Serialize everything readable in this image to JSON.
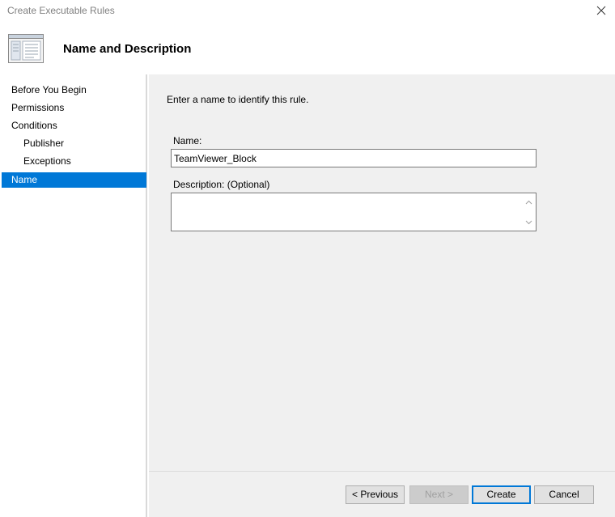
{
  "window": {
    "title": "Create Executable Rules"
  },
  "header": {
    "title": "Name and Description",
    "icon": "wizard-page-icon"
  },
  "nav": {
    "items": [
      {
        "label": "Before You Begin",
        "level": 0,
        "selected": false
      },
      {
        "label": "Permissions",
        "level": 0,
        "selected": false
      },
      {
        "label": "Conditions",
        "level": 0,
        "selected": false
      },
      {
        "label": "Publisher",
        "level": 1,
        "selected": false
      },
      {
        "label": "Exceptions",
        "level": 1,
        "selected": false
      },
      {
        "label": "Name",
        "level": 0,
        "selected": true
      }
    ]
  },
  "main": {
    "instruction": "Enter a name to identify this rule.",
    "name_label": "Name:",
    "name_value": "TeamViewer_Block",
    "description_label": "Description: (Optional)",
    "description_value": ""
  },
  "buttons": {
    "previous": "< Previous",
    "next": "Next >",
    "create": "Create",
    "cancel": "Cancel"
  },
  "colors": {
    "selection": "#0078d7",
    "panel_bg": "#f0f0f0"
  }
}
